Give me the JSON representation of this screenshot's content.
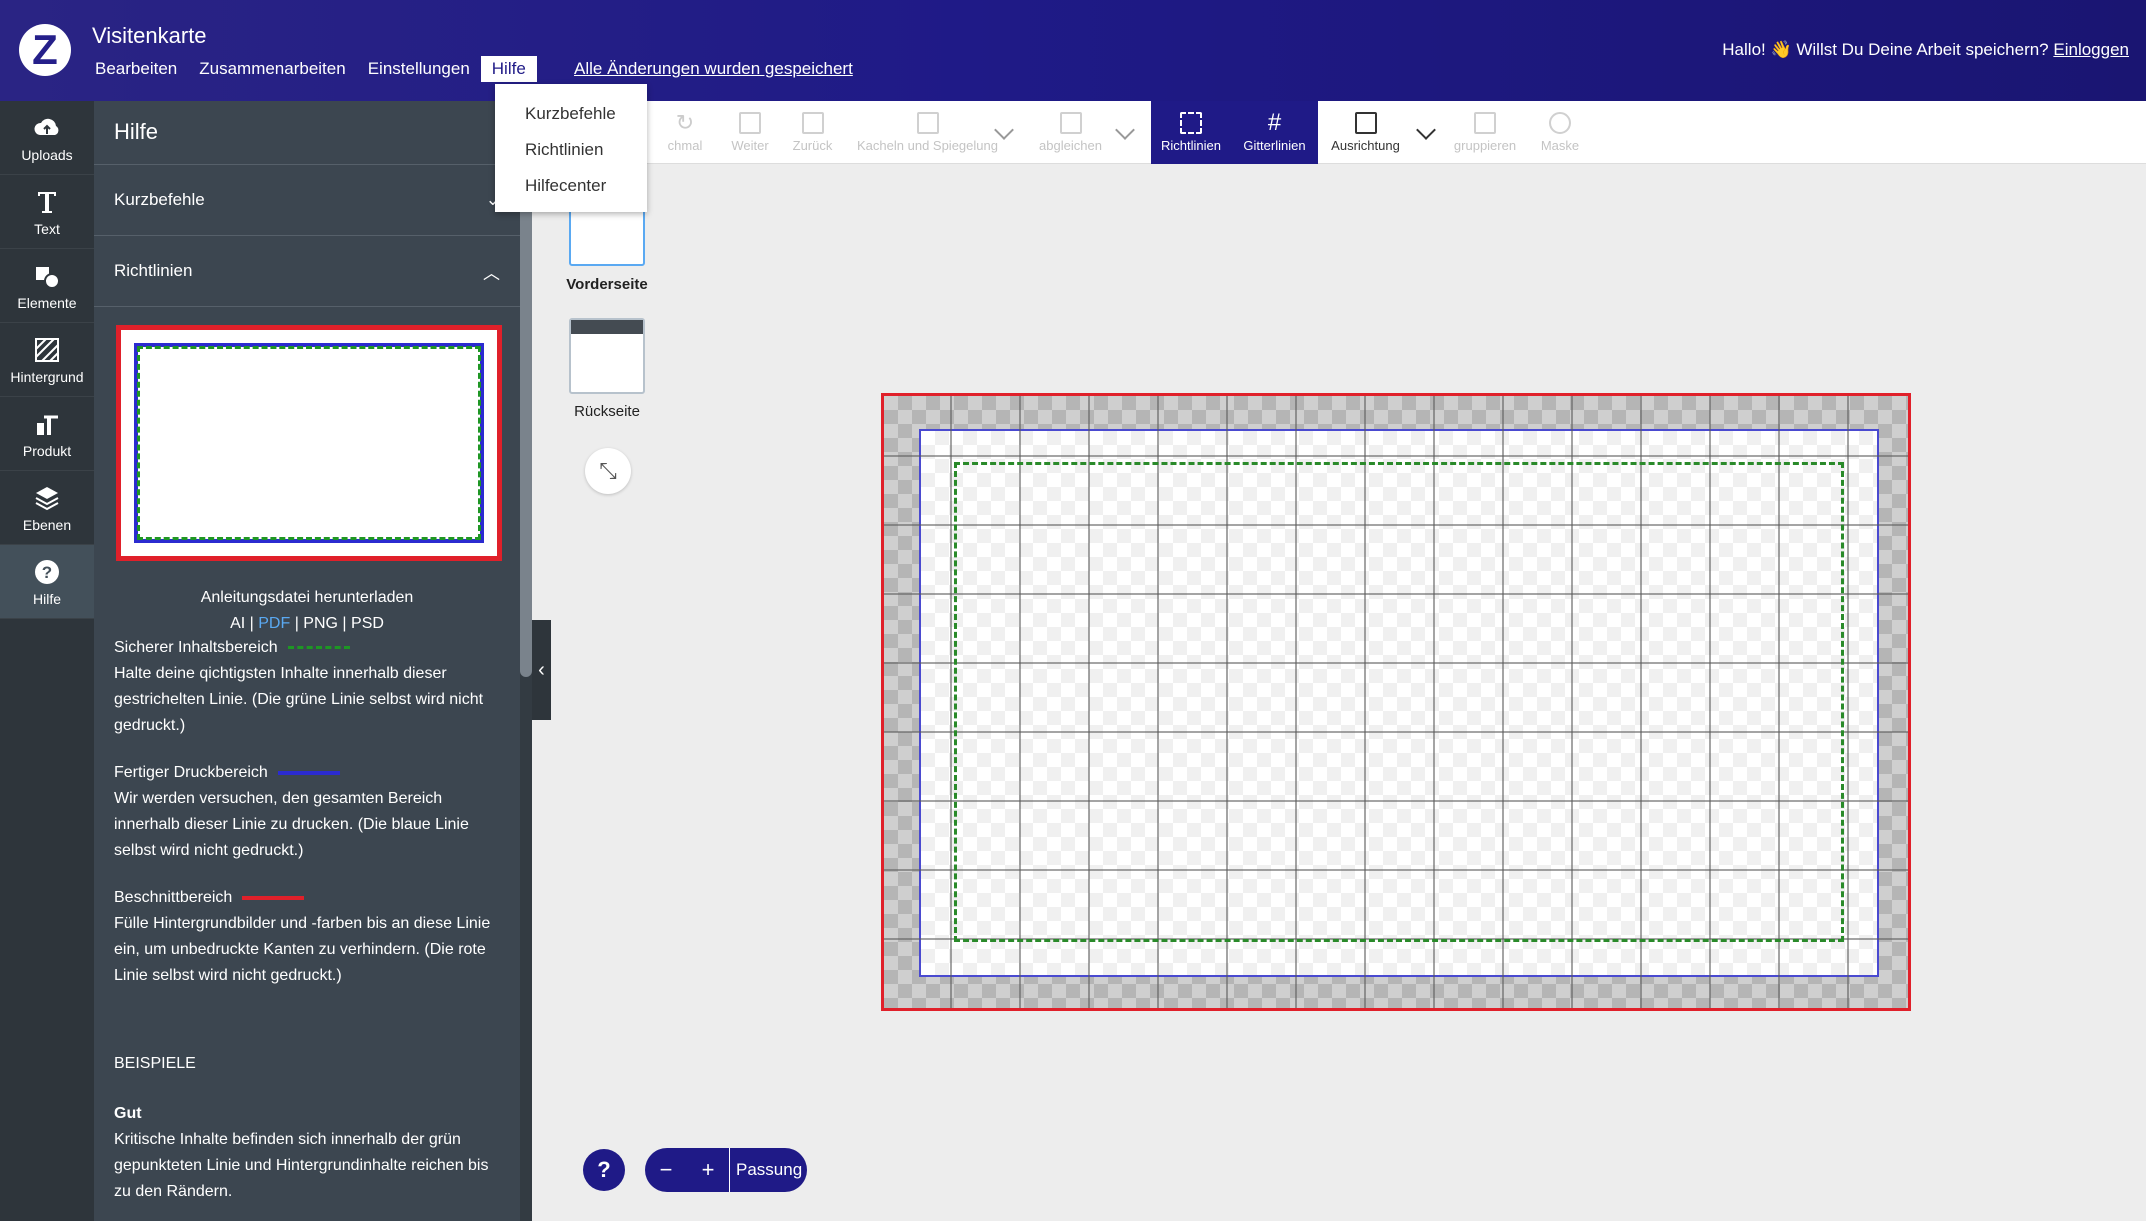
{
  "header": {
    "title": "Visitenkarte",
    "menus": [
      "Bearbeiten",
      "Zusammenarbeiten",
      "Einstellungen",
      "Hilfe"
    ],
    "active_menu": "Hilfe",
    "saved_status": "Alle Änderungen wurden gespeichert",
    "greeting": "Hallo! 👋 Willst Du Deine Arbeit speichern?",
    "login": "Einloggen"
  },
  "help_dropdown": [
    "Kurzbefehle",
    "Richtlinien",
    "Hilfecenter"
  ],
  "rail": [
    {
      "label": "Uploads",
      "icon": "cloud-upload-icon"
    },
    {
      "label": "Text",
      "icon": "text-icon"
    },
    {
      "label": "Elemente",
      "icon": "elements-icon"
    },
    {
      "label": "Hintergrund",
      "icon": "background-icon"
    },
    {
      "label": "Produkt",
      "icon": "product-icon"
    },
    {
      "label": "Ebenen",
      "icon": "layers-icon"
    },
    {
      "label": "Hilfe",
      "icon": "help-icon"
    }
  ],
  "panel": {
    "title": "Hilfe",
    "section_shortcuts": "Kurzbefehle",
    "section_guidelines": "Richtlinien",
    "download_title": "Anleitungsdatei herunterladen",
    "dl_ai": "AI",
    "dl_pdf": "PDF",
    "dl_png": "PNG",
    "dl_psd": "PSD",
    "safe_title": "Sicherer Inhaltsbereich",
    "safe_text": "Halte deine qichtigsten Inhalte innerhalb dieser gestrichelten Linie. (Die grüne Linie selbst wird nicht gedruckt.)",
    "print_title": "Fertiger Druckbereich",
    "print_text": "Wir werden versuchen, den gesamten Bereich innerhalb dieser Linie zu drucken. (Die blaue Linie selbst wird nicht gedruckt.)",
    "bleed_title": "Beschnittbereich",
    "bleed_text": "Fülle Hintergrundbilder und -farben bis an diese Linie ein, um unbedruckte Kanten zu verhindern. (Die rote Linie selbst wird nicht gedruckt.)",
    "examples": "BEISPIELE",
    "good_title": "Gut",
    "good_text": "Kritische Inhalte befinden sich innerhalb der grün gepunkteten Linie und Hintergrundinhalte reichen bis zu den Rändern."
  },
  "toolbar": {
    "nochmal": "chmal",
    "weiter": "Weiter",
    "zurueck": "Zurück",
    "kacheln": "Kacheln und Spiegelung",
    "abgleichen": "abgleichen",
    "richtlinien": "Richtlinien",
    "gitterlinien": "Gitterlinien",
    "ausrichtung": "Ausrichtung",
    "gruppieren": "gruppieren",
    "maske": "Maske"
  },
  "pages": {
    "front": "Vorderseite",
    "back": "Rückseite"
  },
  "zoom": {
    "minus": "−",
    "plus": "+",
    "fit": "Passung"
  },
  "help_button": "?",
  "colors": {
    "brand": "#1f1a87",
    "bleed": "#e0202a",
    "print": "#2b2bd0",
    "safe": "#1e9624"
  }
}
